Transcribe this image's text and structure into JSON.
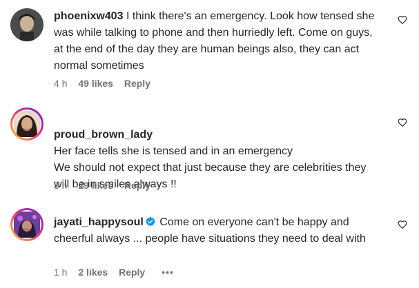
{
  "comments": [
    {
      "username": "phoenixw403",
      "text": "I think there's an emergency. Look how tensed she was while talking to phone and then hurriedly left. Come on guys, at the end of the day they are human beings also, they can act normal sometimes",
      "time": "4 h",
      "likes": "49 likes",
      "reply": "Reply",
      "avatar_icon": "avatar-photo",
      "like_icon": "heart-outline-icon"
    },
    {
      "username": "proud_brown_lady",
      "text": "Her face tells she is tensed and in an emergency\nWe should not expect that just because they are celebrities they will be in smiles always !!",
      "time": "3 h",
      "likes": "29 likes",
      "reply": "Reply",
      "avatar_icon": "avatar-photo",
      "like_icon": "heart-outline-icon"
    },
    {
      "username": "jayati_happysoul",
      "verified": true,
      "text": "Come on everyone can't be happy and cheerful always ... people have situations they need to deal with",
      "time": "1 h",
      "likes": "2 likes",
      "reply": "Reply",
      "more": "•••",
      "avatar_icon": "avatar-photo",
      "like_icon": "heart-outline-icon"
    }
  ],
  "colors": {
    "text": "#262626",
    "secondary": "#737373",
    "verified": "#0095f6",
    "story_ring_start": "#f9ce34",
    "story_ring_end": "#6228d7"
  }
}
